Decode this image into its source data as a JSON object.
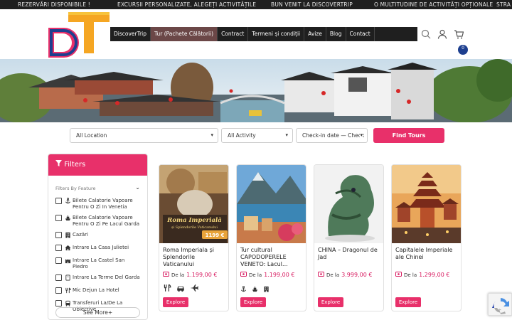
{
  "ticker": [
    "REZERVĂRI DISPONIBILE !",
    "EXCURSII PERSONALIZATE, ALEGEȚI ACTIVITĂȚILE",
    "BUN VENIT LA DISCOVERTRIP",
    "O MULTITUDINE DE ACTIVITĂȚI OPȚIONALE",
    "STRA"
  ],
  "nav": [
    "DiscoverTrip",
    "Tur (Pachete Călătorii)",
    "Contract",
    "Termeni și condiții",
    "Avize",
    "Blog",
    "Contact"
  ],
  "cart_count": "0",
  "search": {
    "location": "All Location",
    "activity": "All Activity",
    "dates": "Check-in date  —  Check",
    "find": "Find Tours"
  },
  "filters": {
    "title": "Filters",
    "by_feature": "Filters By Feature",
    "items": [
      {
        "icon": "anchor-icon",
        "label": "Bilete Calatorie Vapoare Pentru O Zi In Venetia"
      },
      {
        "icon": "ship-icon",
        "label": "Bilete Calatorie Vapoare Pentru O Zi Pe Lacul Garda"
      },
      {
        "icon": "hotel-icon",
        "label": "Cazări"
      },
      {
        "icon": "home-icon",
        "label": "Intrare La Casa Julietei"
      },
      {
        "icon": "castle-icon",
        "label": "Intrare La Castel San Piedro"
      },
      {
        "icon": "spa-icon",
        "label": "Intrare La Terme Del Garda"
      },
      {
        "icon": "breakfast-icon",
        "label": "Mic Dejun La Hotel"
      },
      {
        "icon": "transfer-icon",
        "label": "Transferuri La/De La Obiective"
      }
    ],
    "see_more": "See More+"
  },
  "cards": [
    {
      "title": "Roma Imperiala și Splendorile Vaticanului",
      "price_prefix": "De la",
      "price": "1.199,00 €",
      "amenities": [
        "fork-knife-icon",
        "car-icon",
        "plane-icon"
      ],
      "explore": "Explore",
      "img_title": "Roma Imperială",
      "img_sub": "și Splendorile Vaticanului",
      "img_price": "1199 €"
    },
    {
      "title": "Tur cultural CAPODOPERELE VENETO: Lacul…",
      "price_prefix": "De la",
      "price": "1.199,00 €",
      "amenities": [
        "anchor-icon",
        "ship-icon",
        "hotel-icon"
      ],
      "explore": "Explore"
    },
    {
      "title": "CHINA – Dragonul de Jad",
      "price_prefix": "De la",
      "price": "3.999,00 €",
      "amenities": [],
      "explore": "Explore"
    },
    {
      "title": "Capitalele Imperiale ale Chinei",
      "price_prefix": "De la",
      "price": "1.299,00 €",
      "amenities": [],
      "explore": "Explore"
    }
  ],
  "colors": {
    "accent": "#e8306a",
    "nav_bg": "#1f1f1f",
    "nav_active": "#6b4747",
    "price": "#d81b60"
  }
}
